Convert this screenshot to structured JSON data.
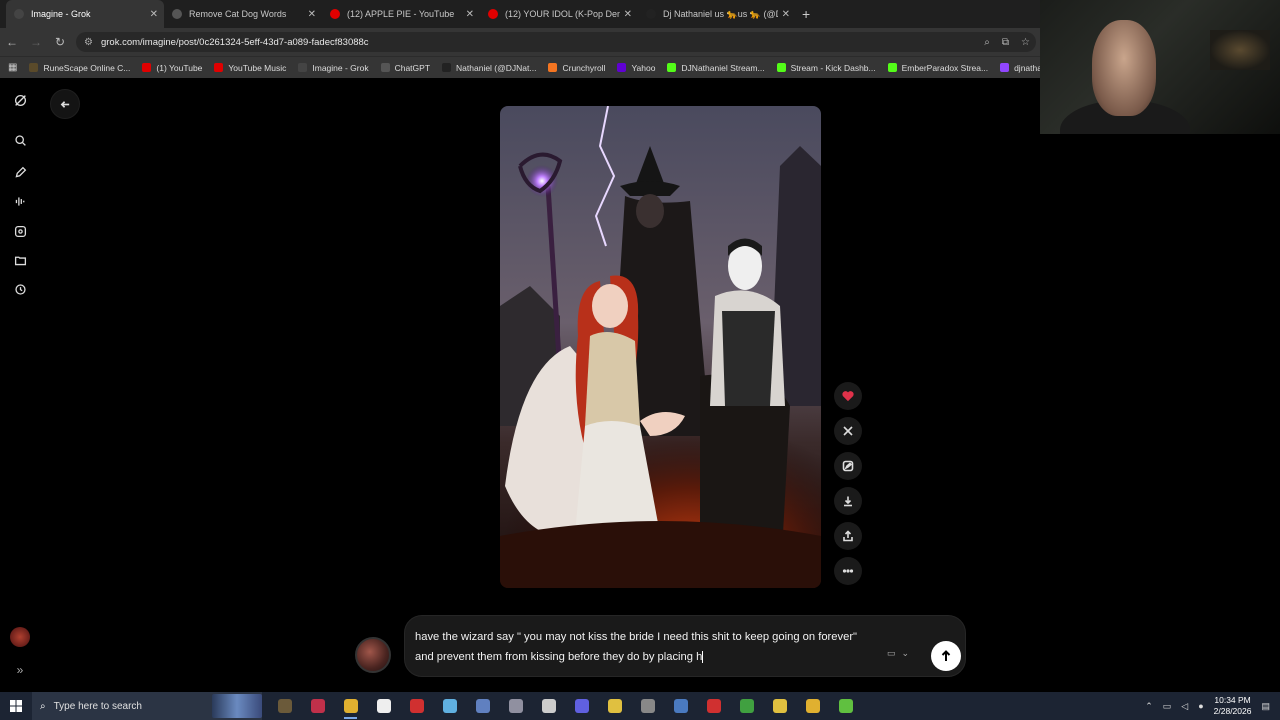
{
  "browser": {
    "tabs": [
      {
        "label": "Imagine - Grok",
        "active": true,
        "icon": "grok-icon",
        "color": "#444444"
      },
      {
        "label": "Remove Cat Dog Words",
        "active": false,
        "icon": "chatgpt-icon",
        "color": "#555555"
      },
      {
        "label": "(12) APPLE PIE - YouTube",
        "active": false,
        "icon": "youtube-icon",
        "color": "#e00000"
      },
      {
        "label": "(12) YOUR IDOL (K-Pop Demon",
        "active": false,
        "icon": "youtube-icon",
        "color": "#e00000"
      },
      {
        "label": "Dj Nathaniel us 🐆us 🐆 (@DJN",
        "active": false,
        "icon": "x-icon",
        "color": "#222222"
      }
    ],
    "url": "grok.com/imagine/post/0c261324-5eff-43d7-a089-fadecf83088c",
    "bookmarks": [
      {
        "label": "RuneScape Online C...",
        "color": "#5a4a2a",
        "glyph": "RS"
      },
      {
        "label": "(1) YouTube",
        "color": "#e00000",
        "glyph": "▶"
      },
      {
        "label": "YouTube Music",
        "color": "#e00000",
        "glyph": "●"
      },
      {
        "label": "Imagine - Grok",
        "color": "#444444",
        "glyph": "G"
      },
      {
        "label": "ChatGPT",
        "color": "#555555",
        "glyph": "✿"
      },
      {
        "label": "Nathaniel (@DJNat...",
        "color": "#222222",
        "glyph": "X"
      },
      {
        "label": "Crunchyroll",
        "color": "#f47521",
        "glyph": "C"
      },
      {
        "label": "Yahoo",
        "color": "#6001d2",
        "glyph": "/"
      },
      {
        "label": "DJNathaniel Stream...",
        "color": "#53fc18",
        "glyph": "K"
      },
      {
        "label": "Stream - Kick Dashb...",
        "color": "#53fc18",
        "glyph": "K"
      },
      {
        "label": "EmberParadox Strea...",
        "color": "#53fc18",
        "glyph": "K"
      },
      {
        "label": "djnathanielrs3 - Twit...",
        "color": "#9146ff",
        "glyph": "T"
      }
    ]
  },
  "sidebar": {
    "items": [
      {
        "name": "grok-logo-icon"
      },
      {
        "name": "search-icon"
      },
      {
        "name": "edit-icon"
      },
      {
        "name": "voice-icon"
      },
      {
        "name": "imagine-icon"
      },
      {
        "name": "folder-icon"
      },
      {
        "name": "history-icon"
      }
    ]
  },
  "actions": [
    "heart-icon",
    "x-share-icon",
    "edit-image-icon",
    "download-icon",
    "share-icon",
    "more-icon"
  ],
  "prompt": {
    "text": "have the wizard say \" you may not kiss the bride I need this shit to keep going on forever\" and prevent them from kissing before they do by placing h"
  },
  "taskbar": {
    "search_placeholder": "Type here to search",
    "time": "10:34 PM",
    "date": "2/28/2026",
    "apps": [
      {
        "name": "runescape-app",
        "color": "#6b5a3a",
        "open": false
      },
      {
        "name": "opera-app",
        "color": "#c0304a",
        "open": false
      },
      {
        "name": "chrome-app",
        "color": "#e0b030",
        "open": true
      },
      {
        "name": "capcut-app",
        "color": "#eeeeee",
        "open": false
      },
      {
        "name": "recorder-app",
        "color": "#d03030",
        "open": false
      },
      {
        "name": "notepad-app",
        "color": "#60b0e0",
        "open": false
      },
      {
        "name": "app-7",
        "color": "#6080c0",
        "open": false
      },
      {
        "name": "app-8",
        "color": "#9090a0",
        "open": false
      },
      {
        "name": "settings-app",
        "color": "#cccccc",
        "open": false
      },
      {
        "name": "app-10",
        "color": "#6060e0",
        "open": false
      },
      {
        "name": "app-11",
        "color": "#e0c040",
        "open": false
      },
      {
        "name": "app-12",
        "color": "#888888",
        "open": false
      },
      {
        "name": "calculator-app",
        "color": "#4a7ac0",
        "open": false
      },
      {
        "name": "app-14",
        "color": "#d03030",
        "open": false
      },
      {
        "name": "app-15",
        "color": "#40a040",
        "open": false
      },
      {
        "name": "app-16",
        "color": "#e0c040",
        "open": false
      },
      {
        "name": "explorer-app",
        "color": "#e0b030",
        "open": false
      },
      {
        "name": "app-18",
        "color": "#60c040",
        "open": false
      }
    ]
  }
}
